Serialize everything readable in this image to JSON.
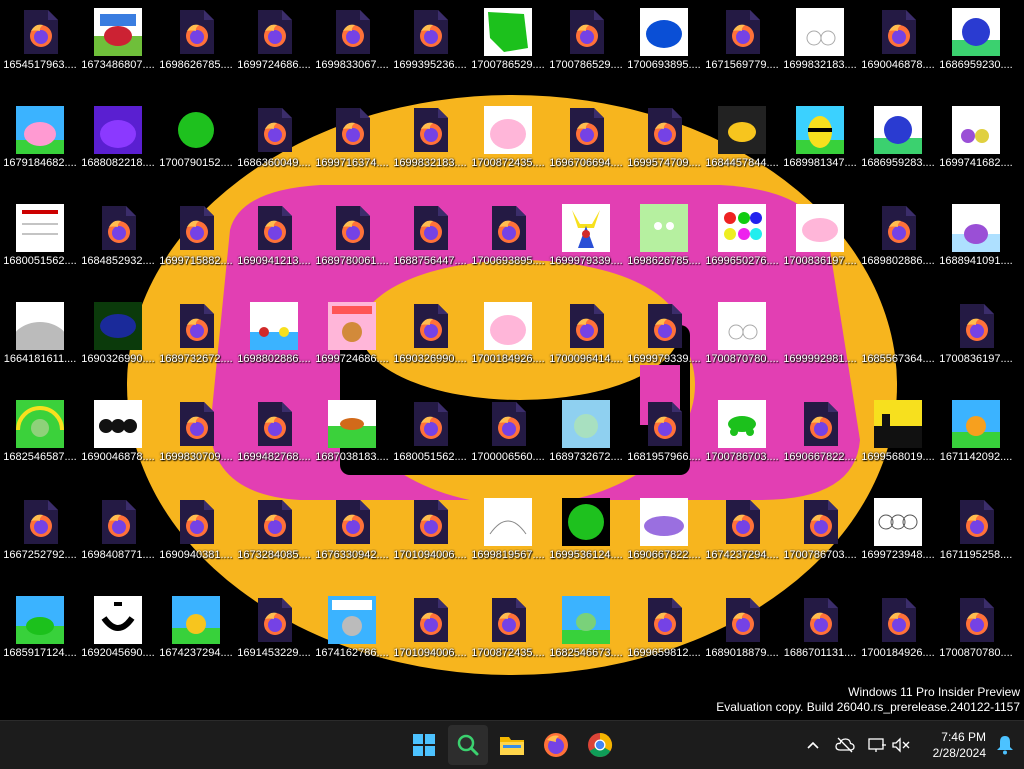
{
  "desktop": {
    "icons": [
      [
        "1654517963....",
        "1673486807....",
        "1698626785....",
        "1699724686....",
        "1699833067....",
        "1699395236....",
        "1700786529....",
        "1700786529....",
        "1700693895....",
        "1671569779....",
        "1699832183....",
        "1690046878....",
        "1686959230...."
      ],
      [
        "1679184682....",
        "1688082218....",
        "1700790152....",
        "1686360049....",
        "1699716374....",
        "1699832183....",
        "1700872435....",
        "1696706694....",
        "1699574709....",
        "1684457844....",
        "1689981347....",
        "1686959283....",
        "1699741682...."
      ],
      [
        "1680051562....",
        "1684852932....",
        "1699715882....",
        "1690941213....",
        "1689780061....",
        "1688756447....",
        "1700693895....",
        "1699979339....",
        "1698626785....",
        "1699650276....",
        "1700836197....",
        "1689802886....",
        "1688941091...."
      ],
      [
        "1664181611....",
        "1690326990....",
        "1689732672....",
        "1698802886....",
        "1699724686....",
        "1690326990....",
        "1700184926....",
        "1700096414....",
        "1699979339....",
        "1700870780....",
        "1699992981....",
        "1685567364....",
        "1700836197...."
      ],
      [
        "1682546587....",
        "1690046878....",
        "1699830709....",
        "1699482768....",
        "1687038183....",
        "1680051562....",
        "1700006560....",
        "1689732672....",
        "1681957966....",
        "1700786703....",
        "1690667822....",
        "1699568019....",
        "1671142092...."
      ],
      [
        "1667252792....",
        "1698408771....",
        "1690940381....",
        "1673284085....",
        "1676330942....",
        "1701094006....",
        "1699819567....",
        "1699536124....",
        "1690667822....",
        "1674237294....",
        "1700786703....",
        "1699723948....",
        "1671195258...."
      ],
      [
        "1685917124....",
        "1692045690....",
        "1674237294....",
        "1691453229....",
        "1674162786....",
        "1701094006....",
        "1700872435....",
        "1682546673....",
        "1699659812....",
        "1689018879....",
        "1686701131....",
        "1700184926....",
        "1700870780...."
      ]
    ],
    "types": [
      [
        "f",
        "img:pig",
        "f",
        "f",
        "f",
        "f",
        "img:green",
        "f",
        "img:blueblob",
        "f",
        "img:white",
        "f",
        "img:bluething"
      ],
      [
        "img:pinkpig",
        "img:purple",
        "img:greencircle",
        "f",
        "f",
        "f",
        "img:pink",
        "f",
        "f",
        "img:dark",
        "img:bee",
        "img:bluething",
        "img:white2"
      ],
      [
        "img:paper",
        "f",
        "f",
        "f",
        "f",
        "f",
        "f",
        "img:pikachu",
        "img:greencard",
        "img:dots",
        "img:pinkblob",
        "f",
        "img:purplething"
      ],
      [
        "img:gray",
        "img:navy",
        "f",
        "img:birds",
        "img:collage",
        "f",
        "img:pink",
        "f",
        "f",
        "img:white",
        "img:cat",
        "img:greenbox",
        "f"
      ],
      [
        "img:rainbow",
        "img:black",
        "f",
        "f",
        "img:field",
        "f",
        "f",
        "img:lightblue",
        "f",
        "img:greencar",
        "f",
        "img:yellow",
        "img:tiger"
      ],
      [
        "f",
        "f",
        "f",
        "f",
        "f",
        "f",
        "img:white3",
        "img:greencircle",
        "img:purpleblob",
        "f",
        "f",
        "img:outline",
        "f"
      ],
      [
        "img:frog",
        "img:smile",
        "img:chick",
        "f",
        "img:collage2",
        "f",
        "f",
        "img:frog2",
        "f",
        "f",
        "f",
        "f",
        "f"
      ]
    ]
  },
  "watermark": {
    "line1": "Windows 11 Pro Insider Preview",
    "line2": "Evaluation copy. Build 26040.rs_prerelease.240122-1157"
  },
  "taskbar": {
    "apps": [
      "start-icon",
      "search-icon",
      "file-explorer-icon",
      "firefox-icon",
      "chrome-icon"
    ]
  },
  "clock": {
    "time": "7:46 PM",
    "date": "2/28/2024"
  },
  "colors": {
    "accent": "#0078d4",
    "wallpaper_yellow": "#f7b51e",
    "wallpaper_pink": "#e23fb3"
  }
}
